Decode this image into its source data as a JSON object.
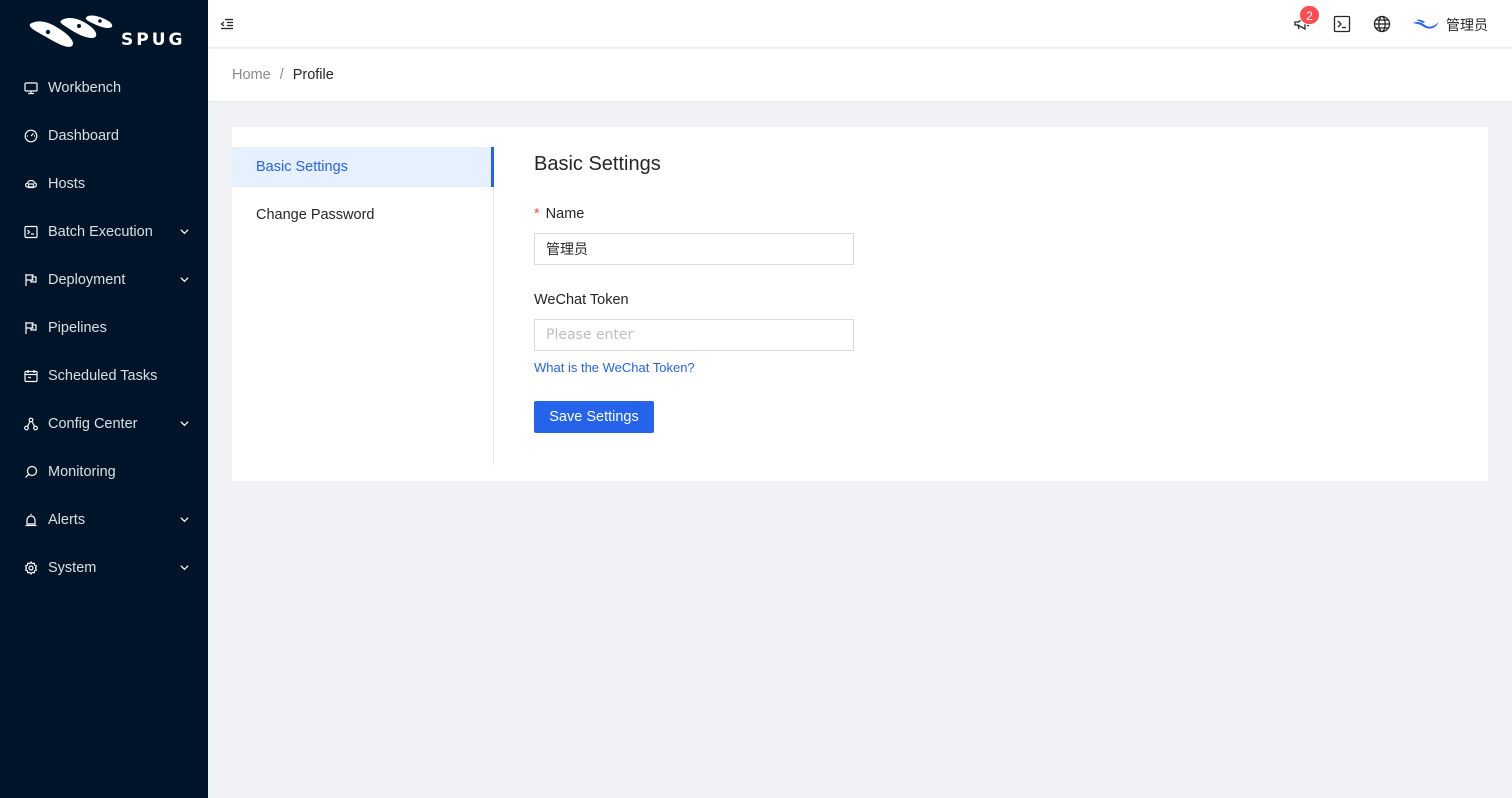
{
  "app": {
    "logo_text": "SPUG"
  },
  "sidebar": {
    "items": [
      {
        "label": "Workbench",
        "icon": "desktop-icon",
        "has_submenu": false
      },
      {
        "label": "Dashboard",
        "icon": "dashboard-icon",
        "has_submenu": false
      },
      {
        "label": "Hosts",
        "icon": "cloud-server-icon",
        "has_submenu": false
      },
      {
        "label": "Batch Execution",
        "icon": "code-icon",
        "has_submenu": true
      },
      {
        "label": "Deployment",
        "icon": "flag-icon",
        "has_submenu": true
      },
      {
        "label": "Pipelines",
        "icon": "flag-icon",
        "has_submenu": false
      },
      {
        "label": "Scheduled Tasks",
        "icon": "schedule-icon",
        "has_submenu": false
      },
      {
        "label": "Config Center",
        "icon": "deployment-unit-icon",
        "has_submenu": true
      },
      {
        "label": "Monitoring",
        "icon": "monitor-icon",
        "has_submenu": false
      },
      {
        "label": "Alerts",
        "icon": "alert-icon",
        "has_submenu": true
      },
      {
        "label": "System",
        "icon": "setting-icon",
        "has_submenu": true
      }
    ]
  },
  "header": {
    "notification_count": "2",
    "user_name": "管理员"
  },
  "breadcrumb": {
    "home": "Home",
    "separator": "/",
    "current": "Profile"
  },
  "profile_menu": {
    "items": [
      {
        "label": "Basic Settings",
        "active": true
      },
      {
        "label": "Change Password",
        "active": false
      }
    ]
  },
  "form": {
    "title": "Basic Settings",
    "name_label": "Name",
    "name_required_mark": "*",
    "name_value": "管理员",
    "wechat_label": "WeChat Token",
    "wechat_value": "",
    "wechat_placeholder": "Please enter",
    "help_link": "What is the WeChat Token?",
    "save_button": "Save Settings"
  },
  "colors": {
    "sidebar_bg": "#001529",
    "primary": "#2563eb",
    "danger": "#ff4d4f",
    "page_bg": "#f0f2f5"
  }
}
